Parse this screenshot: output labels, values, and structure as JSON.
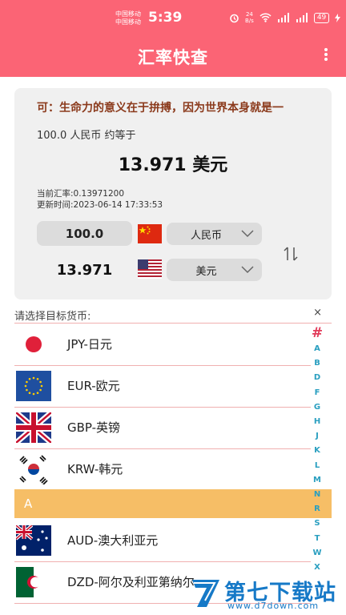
{
  "status_bar": {
    "carrier_1": "中国移动",
    "carrier_2": "中国移动",
    "time": "5:39",
    "net_speed_top": "24",
    "net_speed_bottom": "B/s",
    "battery": "49"
  },
  "header": {
    "title": "汇率快查",
    "background": "#fb6475"
  },
  "converter": {
    "marquee_text": "可：生命力的意义在于拚搏，因为世界本身就是一",
    "amount_line": "100.0 人民币 约等于",
    "result": "13.971 美元",
    "rate_text": "当前汇率:0.13971200",
    "update_text": "更新时间:2023-06-14 17:33:53",
    "from_amount": "100.0",
    "from_currency": "人民币",
    "to_amount": "13.971",
    "to_currency": "美元"
  },
  "currency_list": {
    "header_label": "请选择目标货币:",
    "close_icon": "×",
    "items": [
      {
        "label": "JPY-日元",
        "icon": "japan-flag-icon"
      },
      {
        "label": "EUR-欧元",
        "icon": "eu-flag-icon"
      },
      {
        "label": "GBP-英镑",
        "icon": "uk-flag-icon"
      },
      {
        "label": "KRW-韩元",
        "icon": "korea-flag-icon"
      }
    ],
    "section_a": "A",
    "section_items": [
      {
        "label": "AUD-澳大利亚元",
        "icon": "australia-flag-icon"
      },
      {
        "label": "DZD-阿尔及利亚第纳尔",
        "icon": "algeria-flag-icon"
      }
    ]
  },
  "index_bar": {
    "hash": "#",
    "letters": [
      "A",
      "B",
      "D",
      "F",
      "G",
      "H",
      "J",
      "K",
      "L",
      "M",
      "N",
      "R",
      "S",
      "T",
      "W",
      "X"
    ]
  },
  "watermark": {
    "name": "第七下载站",
    "url": "www.d7down.com"
  },
  "colors": {
    "accent": "#fb6475",
    "section_highlight": "#f6be66",
    "index_letter": "#2a9fc0",
    "index_hash": "#e23b5a"
  }
}
